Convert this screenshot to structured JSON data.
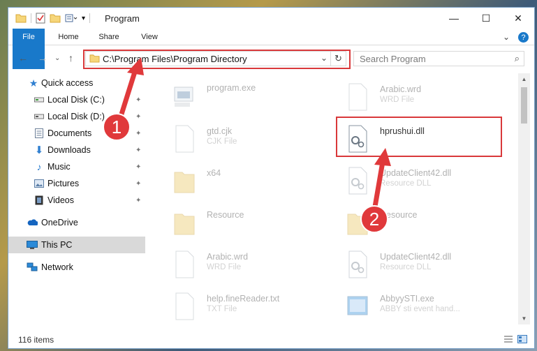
{
  "window": {
    "title": "Program",
    "minimize_glyph": "—",
    "maximize_glyph": "☐",
    "close_glyph": "✕"
  },
  "ribbon": {
    "tabs": [
      "File",
      "Home",
      "Share",
      "View"
    ],
    "expand_glyph": "⌄",
    "help_glyph": "?"
  },
  "address": {
    "path": "C:\\Program Files\\Program Directory",
    "dropdown_glyph": "⌄",
    "refresh_glyph": "↻"
  },
  "nav": {
    "back_glyph": "←",
    "forward_glyph": "→",
    "recent_glyph": "⌄",
    "up_glyph": "↑"
  },
  "search": {
    "placeholder": "Search Program",
    "icon_glyph": "⌕"
  },
  "sidebar": {
    "items": [
      {
        "label": "Quick access",
        "icon": "star-icon",
        "pinned": false
      },
      {
        "label": "Local Disk (C:)",
        "icon": "drive-icon",
        "pinned": true
      },
      {
        "label": "Local Disk (D:)",
        "icon": "drive-icon",
        "pinned": true
      },
      {
        "label": "Documents",
        "icon": "documents-icon",
        "pinned": true
      },
      {
        "label": "Downloads",
        "icon": "download-icon",
        "pinned": true
      },
      {
        "label": "Music",
        "icon": "music-icon",
        "pinned": true
      },
      {
        "label": "Pictures",
        "icon": "pictures-icon",
        "pinned": true
      },
      {
        "label": "Videos",
        "icon": "videos-icon",
        "pinned": true
      },
      {
        "label": "OneDrive",
        "icon": "cloud-icon",
        "pinned": false
      },
      {
        "label": "This PC",
        "icon": "computer-icon",
        "pinned": false,
        "selected": true
      },
      {
        "label": "Network",
        "icon": "network-icon",
        "pinned": false
      }
    ],
    "pin_glyph": "📌"
  },
  "files": [
    {
      "name": "program.exe",
      "type": "",
      "kind": "exe"
    },
    {
      "name": "Arabic.wrd",
      "type": "WRD File",
      "kind": "doc"
    },
    {
      "name": "gtd.cjk",
      "type": "CJK File",
      "kind": "doc"
    },
    {
      "name": "hprushui.dll",
      "type": "",
      "kind": "dll",
      "highlighted": true
    },
    {
      "name": "x64",
      "type": "",
      "kind": "folder"
    },
    {
      "name": "UpdateClient42.dll",
      "type": "Resource DLL",
      "kind": "dll"
    },
    {
      "name": "Resource",
      "type": "",
      "kind": "folder"
    },
    {
      "name": "Resource",
      "type": "",
      "kind": "folder"
    },
    {
      "name": "Arabic.wrd",
      "type": "WRD File",
      "kind": "doc"
    },
    {
      "name": "UpdateClient42.dll",
      "type": "Resource DLL",
      "kind": "dll"
    },
    {
      "name": "help.fineReader.txt",
      "type": "TXT File",
      "kind": "doc"
    },
    {
      "name": "AbbyySTI.exe",
      "type": "ABBY sti event hand...",
      "kind": "app"
    }
  ],
  "status": {
    "item_count": "116 items"
  },
  "annotations": {
    "step1": "1",
    "step2": "2",
    "color": "#e0393b"
  }
}
